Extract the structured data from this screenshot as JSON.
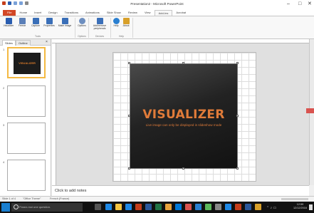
{
  "window": {
    "title": "Presentation2 - Microsoft PowerPoint",
    "minimize": "–",
    "maximize": "□",
    "close": "✕"
  },
  "ribbon_tabs": [
    {
      "label": "File"
    },
    {
      "label": "Home"
    },
    {
      "label": "Insert"
    },
    {
      "label": "Design"
    },
    {
      "label": "Transitions"
    },
    {
      "label": "Animations"
    },
    {
      "label": "Slide Show"
    },
    {
      "label": "Review"
    },
    {
      "label": "View"
    },
    {
      "label": "Add-Ins"
    },
    {
      "label": "Acrobat"
    }
  ],
  "ribbon": {
    "buttons": [
      {
        "label": "Visualizer",
        "icon": "visualizer-icon",
        "color": "#2a5db0"
      },
      {
        "label": "Freeze",
        "icon": "freeze-icon",
        "color": "#5a7fb8"
      },
      {
        "label": "Capture",
        "icon": "capture-icon",
        "color": "#3a6fb8"
      },
      {
        "label": "Properties",
        "icon": "properties-icon",
        "color": "#3a6fb8"
      },
      {
        "label": "Make image",
        "icon": "image-icon",
        "color": "#3a6fb8"
      },
      {
        "label": "Options",
        "icon": "options-icon",
        "color": "#6e8fc0"
      },
      {
        "label": "Add/remove peripherals",
        "icon": "peripherals-icon",
        "color": "#3a6fb8"
      },
      {
        "label": "Help",
        "icon": "help-icon",
        "color": "#2a7fd0"
      },
      {
        "label": "About",
        "icon": "about-icon",
        "color": "#d8a02a"
      }
    ],
    "groups": [
      "Tools",
      "Options",
      "Devices",
      "Help"
    ]
  },
  "panel": {
    "tab_slides": "Slides",
    "tab_outline": "Outline",
    "close": "×",
    "slides": [
      {
        "num": "1",
        "caption": "VISUALIZER"
      },
      {
        "num": "2"
      },
      {
        "num": "3"
      },
      {
        "num": "4"
      }
    ]
  },
  "slide": {
    "title": "VISUALIZER",
    "subtitle": "Live image can only be displayed in slideshow mode"
  },
  "notes": {
    "placeholder": "Click to add notes"
  },
  "status": {
    "slide_count": "Slide 1 of 4",
    "theme": "\"Office Theme\"",
    "language": "French (France)"
  },
  "taskbar": {
    "search_placeholder": "Posez-moi une question.",
    "time": "12:59",
    "date": "12/12/2016"
  },
  "colors": {
    "file_tab": "#d24726",
    "accent": "#e07b39",
    "selection": "#f4b942"
  }
}
